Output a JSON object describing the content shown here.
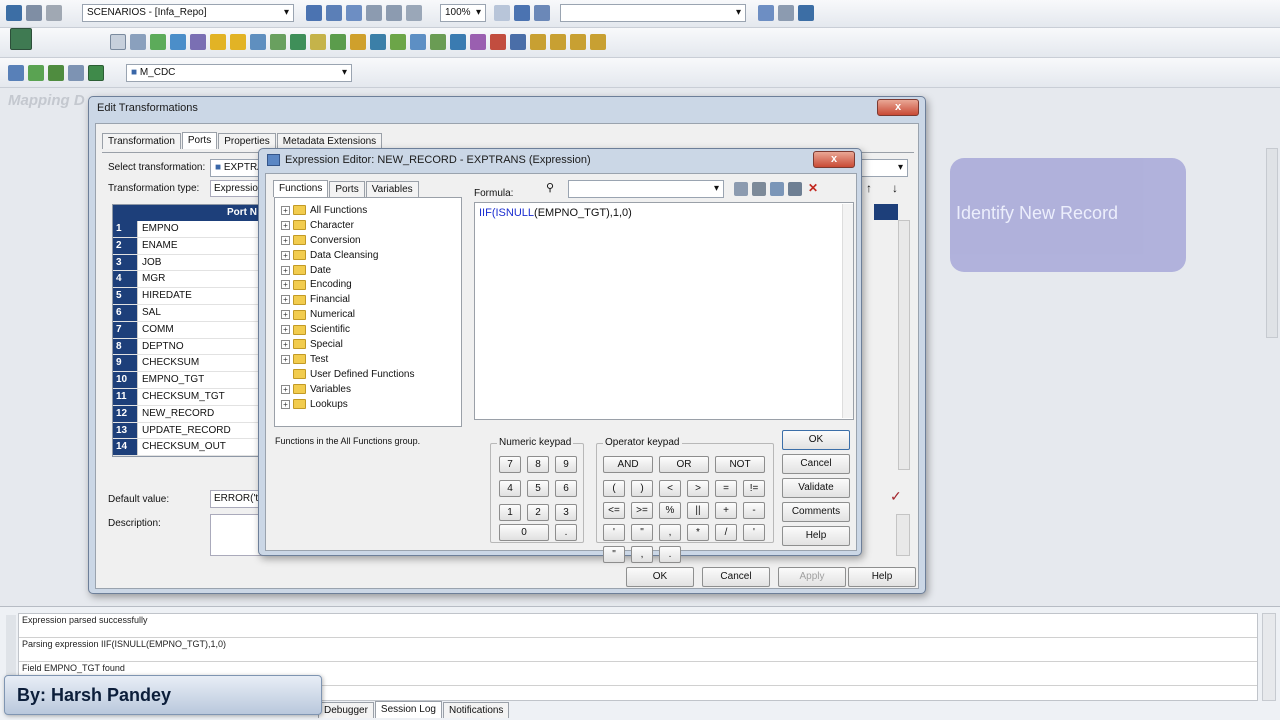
{
  "toolbar1": {
    "repo_dropdown": "SCENARIOS - [Infa_Repo]",
    "zoom": "100%"
  },
  "toolbar3": {
    "mapping_dropdown": "M_CDC"
  },
  "canvas": {
    "watermark": "Mapping D",
    "node_label": "Identify New Record"
  },
  "edit_dialog": {
    "title": "Edit Transformations",
    "close": "x",
    "tabs": [
      "Transformation",
      "Ports",
      "Properties",
      "Metadata Extensions"
    ],
    "select_label": "Select transformation:",
    "select_value": "EXPTRANS",
    "type_label": "Transformation type:",
    "type_value": "Expression",
    "grid_header": "Port N",
    "ports": [
      {
        "num": "1",
        "name": "EMPNO"
      },
      {
        "num": "2",
        "name": "ENAME"
      },
      {
        "num": "3",
        "name": "JOB"
      },
      {
        "num": "4",
        "name": "MGR"
      },
      {
        "num": "5",
        "name": "HIREDATE"
      },
      {
        "num": "6",
        "name": "SAL"
      },
      {
        "num": "7",
        "name": "COMM"
      },
      {
        "num": "8",
        "name": "DEPTNO"
      },
      {
        "num": "9",
        "name": "CHECKSUM"
      },
      {
        "num": "10",
        "name": "EMPNO_TGT"
      },
      {
        "num": "11",
        "name": "CHECKSUM_TGT"
      },
      {
        "num": "12",
        "name": "NEW_RECORD"
      },
      {
        "num": "13",
        "name": "UPDATE_RECORD"
      },
      {
        "num": "14",
        "name": "CHECKSUM_OUT"
      }
    ],
    "default_label": "Default value:",
    "default_value": "ERROR('tr",
    "description_label": "Description:",
    "buttons": {
      "ok": "OK",
      "cancel": "Cancel",
      "apply": "Apply",
      "help": "Help"
    }
  },
  "expr_editor": {
    "title": "Expression Editor: NEW_RECORD - EXPTRANS (Expression)",
    "close": "x",
    "tabs": [
      "Functions",
      "Ports",
      "Variables"
    ],
    "tree": [
      {
        "label": "All Functions",
        "expand": "+"
      },
      {
        "label": "Character",
        "expand": "+"
      },
      {
        "label": "Conversion",
        "expand": "+"
      },
      {
        "label": "Data Cleansing",
        "expand": "+"
      },
      {
        "label": "Date",
        "expand": "+"
      },
      {
        "label": "Encoding",
        "expand": "+"
      },
      {
        "label": "Financial",
        "expand": "+"
      },
      {
        "label": "Numerical",
        "expand": "+"
      },
      {
        "label": "Scientific",
        "expand": "+"
      },
      {
        "label": "Special",
        "expand": "+"
      },
      {
        "label": "Test",
        "expand": "+"
      },
      {
        "label": "User Defined Functions",
        "expand": ""
      },
      {
        "label": "Variables",
        "expand": "+"
      },
      {
        "label": "Lookups",
        "expand": "+"
      }
    ],
    "tree_desc": "Functions in the All Functions group.",
    "formula_label": "Formula:",
    "formula_kw1": "IIF(",
    "formula_kw2": "ISNULL",
    "formula_rest": "(EMPNO_TGT),1,0)",
    "numeric_label": "Numeric keypad",
    "numeric_keys": [
      "7",
      "8",
      "9",
      "4",
      "5",
      "6",
      "1",
      "2",
      "3",
      "0",
      "."
    ],
    "operator_label": "Operator keypad",
    "logic_keys": [
      "AND",
      "OR",
      "NOT"
    ],
    "operator_keys": [
      "(",
      ")",
      "<",
      ">",
      "=",
      "!=",
      "<=",
      ">=",
      "%",
      "||",
      "+",
      "-",
      "'",
      "\"",
      ",",
      "*",
      "/",
      "'",
      "\"",
      ",",
      "."
    ],
    "buttons": {
      "ok": "OK",
      "cancel": "Cancel",
      "validate": "Validate",
      "comments": "Comments",
      "help": "Help"
    }
  },
  "output_log": {
    "lines": [
      "Expression parsed successfully",
      "Parsing expression IIF(ISNULL(EMPNO_TGT),1,0)",
      "Field EMPNO_TGT found"
    ],
    "tabs": [
      "Debugger",
      "Session Log",
      "Notifications"
    ]
  },
  "watermark_banner": "By: Harsh Pandey",
  "colors": {
    "accent": "#1d3f7a",
    "keyword": "#1a2dd0",
    "node": "#a7a8d8"
  }
}
